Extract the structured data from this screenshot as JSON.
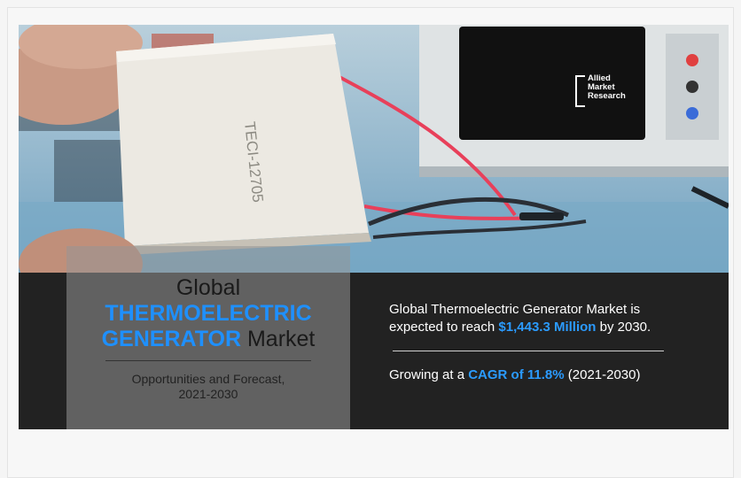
{
  "logo": {
    "line1": "Allied",
    "line2": "Market",
    "line3": "Research"
  },
  "module_label": "TECI-12705",
  "panel": {
    "title_line1": "Global",
    "title_highlight_1": "THERMOELECTRIC",
    "title_highlight_2": "GENERATOR",
    "title_suffix": " Market",
    "subtitle_line1": "Opportunities and Forecast,",
    "subtitle_line2": "2021-2030"
  },
  "stats": {
    "line1": "Global Thermoelectric Generator Market is",
    "line2_prefix": "expected to reach ",
    "line2_value": "$1,443.3 Million",
    "line2_suffix": " by 2030.",
    "growth_prefix": "Growing at a ",
    "growth_value": "CAGR of 11.8%",
    "growth_suffix": " (2021-2030)"
  },
  "colors": {
    "highlight": "#2b9bff",
    "band": "#222222",
    "panel": "#969696"
  }
}
